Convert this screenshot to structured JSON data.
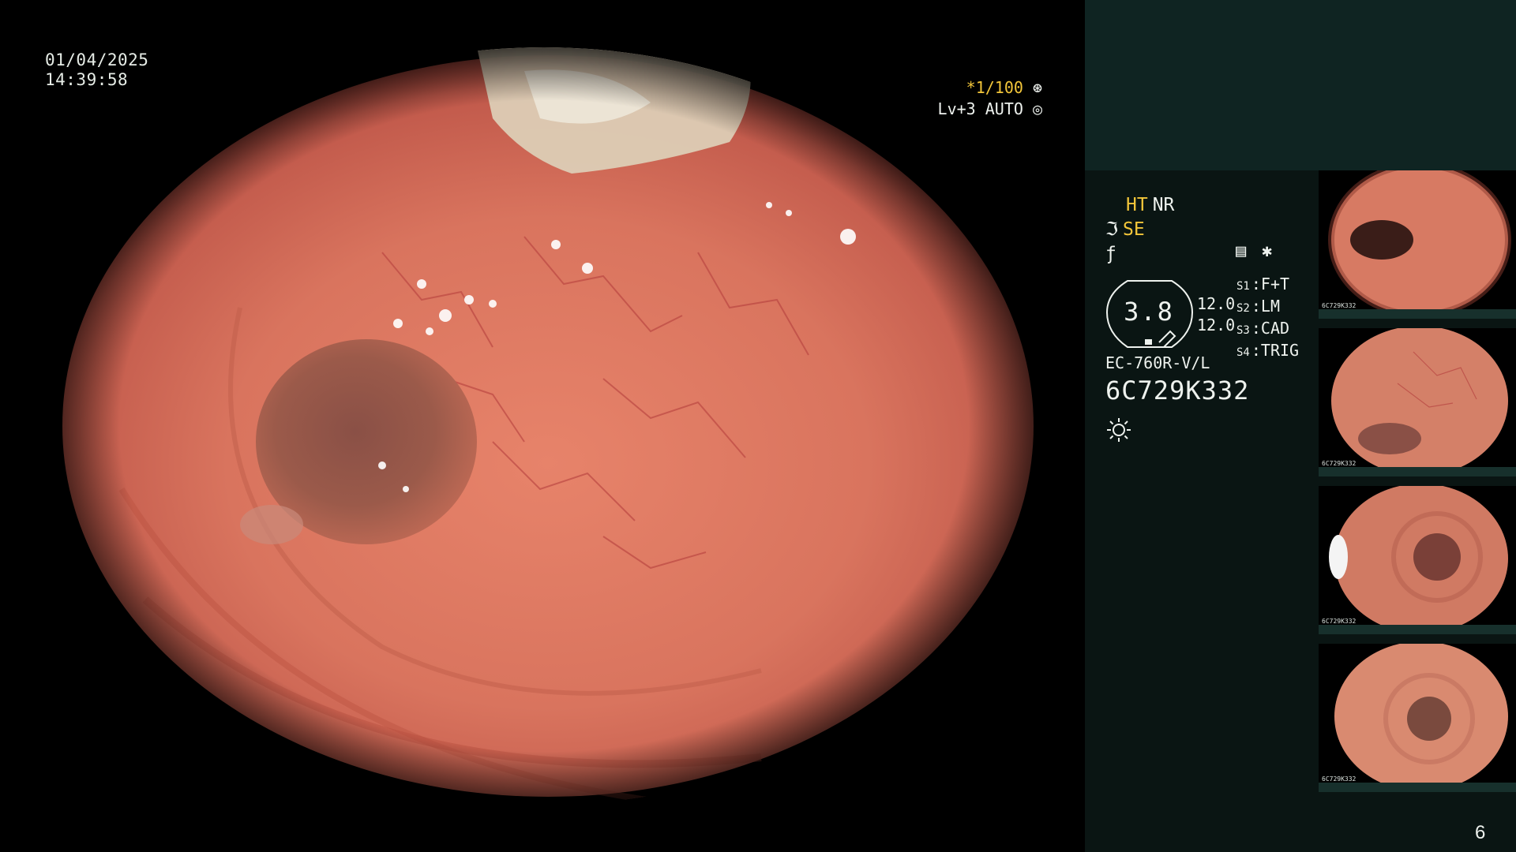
{
  "main_view": {
    "date": "01/04/2025",
    "time": "14:39:58",
    "shutter": "*1/100",
    "level": "Lv+3 AUTO"
  },
  "status": {
    "ht": "HT",
    "nr": "NR",
    "se": "SE"
  },
  "scope": {
    "gauge_value": "3.8",
    "pressure_top": "12.0",
    "pressure_bottom": "12.0",
    "modes": [
      {
        "key": "S1",
        "value": "F+T"
      },
      {
        "key": "S2",
        "value": "LM"
      },
      {
        "key": "S3",
        "value": "CAD"
      },
      {
        "key": "S4",
        "value": "TRIG"
      }
    ],
    "model": "EC-760R-V/L",
    "serial": "6C729K332"
  },
  "thumbnails": [
    {
      "label": "6C729K332",
      "index": 0
    },
    {
      "label": "6C729K332",
      "index": 1
    },
    {
      "label": "6C729K332",
      "index": 2
    },
    {
      "label": "6C729K332",
      "index": 3
    }
  ],
  "page_number": "6",
  "colors": {
    "accent_yellow": "#f3c63a",
    "panel_bg": "#0a1513",
    "panel_top_bg": "#0f2422"
  }
}
